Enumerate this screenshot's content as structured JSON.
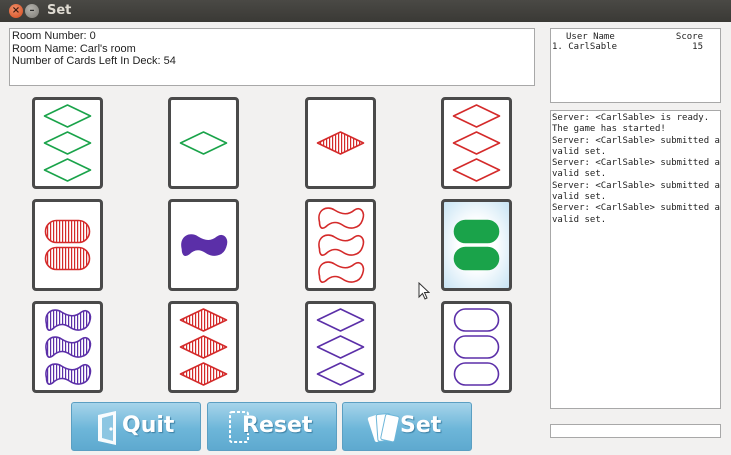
{
  "window": {
    "title": "Set"
  },
  "room": {
    "number_line": "Room Number: 0",
    "name_line": "Room Name:  Carl's room",
    "cards_left_line": "Number of Cards Left In Deck: 54"
  },
  "scoreboard": {
    "header_name": "User Name",
    "header_score": "Score",
    "rows": [
      {
        "name": "1. CarlSable",
        "score": "15"
      }
    ]
  },
  "log": {
    "text": "Server: <CarlSable> is ready.\nThe game has started!\nServer: <CarlSable> submitted a\nvalid set.\nServer: <CarlSable> submitted a\nvalid set.\nServer: <CarlSable> submitted a\nvalid set.\nServer: <CarlSable> submitted a\nvalid set."
  },
  "chat": {
    "value": ""
  },
  "colors": {
    "green": "#1aa34a",
    "red": "#d42a2a",
    "purple": "#5b2fa8",
    "button": "#6db6d9"
  },
  "buttons": {
    "quit": {
      "label": "Quit",
      "icon": "door-icon"
    },
    "reset": {
      "label": "Reset",
      "icon": "reset-card-icon"
    },
    "set": {
      "label": "Set",
      "icon": "cards-icon"
    }
  },
  "cards": [
    {
      "count": 3,
      "shape": "diamond",
      "color": "green",
      "fill": "empty",
      "selected": false
    },
    {
      "count": 1,
      "shape": "diamond",
      "color": "green",
      "fill": "empty",
      "selected": false
    },
    {
      "count": 1,
      "shape": "diamond",
      "color": "red",
      "fill": "striped",
      "selected": false
    },
    {
      "count": 3,
      "shape": "diamond",
      "color": "red",
      "fill": "empty",
      "selected": false
    },
    {
      "count": 2,
      "shape": "oval",
      "color": "red",
      "fill": "striped",
      "selected": false
    },
    {
      "count": 1,
      "shape": "squiggle",
      "color": "purple",
      "fill": "solid",
      "selected": false
    },
    {
      "count": 3,
      "shape": "squiggle",
      "color": "red",
      "fill": "empty",
      "selected": false
    },
    {
      "count": 2,
      "shape": "oval",
      "color": "green",
      "fill": "solid",
      "selected": true
    },
    {
      "count": 3,
      "shape": "squiggle",
      "color": "purple",
      "fill": "striped",
      "selected": false
    },
    {
      "count": 3,
      "shape": "diamond",
      "color": "red",
      "fill": "striped",
      "selected": false
    },
    {
      "count": 3,
      "shape": "diamond",
      "color": "purple",
      "fill": "empty",
      "selected": false
    },
    {
      "count": 3,
      "shape": "oval",
      "color": "purple",
      "fill": "empty",
      "selected": false
    }
  ]
}
